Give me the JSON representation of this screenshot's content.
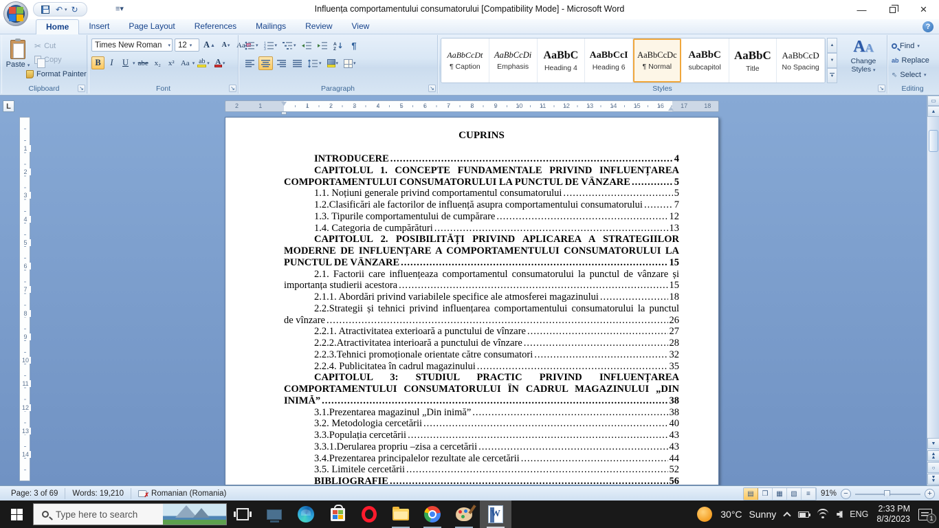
{
  "window": {
    "title": "Influența comportamentului consumatorului [Compatibility Mode]  -  Microsoft Word"
  },
  "ribbon": {
    "tabs": [
      {
        "label": "Home",
        "active": true
      },
      {
        "label": "Insert",
        "active": false
      },
      {
        "label": "Page Layout",
        "active": false
      },
      {
        "label": "References",
        "active": false
      },
      {
        "label": "Mailings",
        "active": false
      },
      {
        "label": "Review",
        "active": false
      },
      {
        "label": "View",
        "active": false
      }
    ],
    "clipboard": {
      "label": "Clipboard",
      "paste": "Paste",
      "cut": "Cut",
      "copy": "Copy",
      "format_painter": "Format Painter"
    },
    "font": {
      "label": "Font",
      "family": "Times New Roman",
      "size": "12"
    },
    "paragraph": {
      "label": "Paragraph"
    },
    "styles": {
      "label": "Styles",
      "change_styles": "Change Styles",
      "items": [
        {
          "preview": "AaBbCcDt",
          "name": "¶ Caption",
          "format": "caption",
          "selected": false
        },
        {
          "preview": "AaBbCcDi",
          "name": "Emphasis",
          "format": "emphasis",
          "selected": false
        },
        {
          "preview": "AaBbC",
          "name": "Heading 4",
          "format": "h4",
          "selected": false
        },
        {
          "preview": "AaBbCcI",
          "name": "Heading 6",
          "format": "h6",
          "selected": false
        },
        {
          "preview": "AaBbCcDc",
          "name": "¶ Normal",
          "format": "normal",
          "selected": true
        },
        {
          "preview": "AaBbC",
          "name": "subcapitol",
          "format": "subcapitol",
          "selected": false
        },
        {
          "preview": "AaBbC",
          "name": "Title",
          "format": "title",
          "selected": false
        },
        {
          "preview": "AaBbCcD",
          "name": "No Spacing",
          "format": "nospacing",
          "selected": false
        }
      ]
    },
    "editing": {
      "label": "Editing",
      "find": "Find",
      "replace": "Replace",
      "select": "Select"
    }
  },
  "ruler": {
    "left_numbers": [
      "2",
      "1"
    ],
    "center_numbers": [
      "1",
      "2",
      "3",
      "4",
      "5",
      "6",
      "7",
      "8",
      "9",
      "10",
      "11",
      "12",
      "13",
      "14",
      "15",
      "16"
    ],
    "right_numbers": [
      "17",
      "18"
    ],
    "vertical_numbers": [
      "1",
      "2",
      "3",
      "4",
      "5",
      "6",
      "7",
      "8",
      "9",
      "10",
      "11",
      "12",
      "13",
      "14"
    ]
  },
  "document": {
    "title": "CUPRINS",
    "toc": [
      {
        "lines": [
          "INTRODUCERE"
        ],
        "page": "4",
        "bold": true
      },
      {
        "lines": [
          "CAPITOLUL 1.  CONCEPTE FUNDAMENTALE  PRIVIND INFLUENȚAREA",
          "COMPORTAMENTULUI CONSUMATORULUI LA PUNCTUL DE VÂNZARE"
        ],
        "page": "5",
        "bold": true
      },
      {
        "lines": [
          "1.1. Noțiuni generale privind  comportamentul consumatorului"
        ],
        "page": "5",
        "bold": false
      },
      {
        "lines": [
          "1.2.Clasificări ale factorilor de influență asupra comportamentului consumatorului"
        ],
        "page": "7",
        "bold": false
      },
      {
        "lines": [
          "1.3. Tipurile comportamentului de cumpărare"
        ],
        "page": "12",
        "bold": false
      },
      {
        "lines": [
          "1.4. Categoria de cumpărături"
        ],
        "page": "13",
        "bold": false
      },
      {
        "lines": [
          "CAPITOLUL 2. POSIBILITĂȚI PRIVIND APLICAREA A STRATEGIILOR",
          "MODERNE DE INFLUENȚARE A COMPORTAMENTULUI CONSUMATORULUI LA",
          "PUNCTUL DE VÂNZARE"
        ],
        "page": "15",
        "bold": true
      },
      {
        "lines": [
          "2.1. Factorii care influențeaza comportamentul consumatorului la punctul de vânzare și",
          "importanța studierii acestora"
        ],
        "page": "15",
        "bold": false
      },
      {
        "lines": [
          "2.1.1. Abordări privind variabilele specifice ale atmosferei magazinului"
        ],
        "page": "18",
        "bold": false
      },
      {
        "lines": [
          "2.2.Strategii și tehnici privind influențarea comportamentului consumatorului la punctul",
          "de vînzare"
        ],
        "page": "26",
        "bold": false
      },
      {
        "lines": [
          "2.2.1. Atractivitatea exterioară a punctului de vînzare"
        ],
        "page": "27",
        "bold": false
      },
      {
        "lines": [
          "2.2.2.Atractivitatea interioară  a punctului de vînzare"
        ],
        "page": "28",
        "bold": false
      },
      {
        "lines": [
          "2.2.3.Tehnici promoționale orientate către consumatori"
        ],
        "page": "32",
        "bold": false
      },
      {
        "lines": [
          "2.2.4.  Publicitatea în cadrul magazinului"
        ],
        "page": "35",
        "bold": false
      },
      {
        "lines": [
          "CAPITOLUL   3:   STUDIUL   PRACTIC   PRIVIND   INFLUENȚAREA",
          "COMPORTAMENTULUI CONSUMATORULUI ÎN CADRUL MAGAZINULUI „DIN",
          "INIMĂ”"
        ],
        "page": "38",
        "bold": true
      },
      {
        "lines": [
          "3.1.Prezentarea magazinul  „Din inimă”"
        ],
        "page": "38",
        "bold": false
      },
      {
        "lines": [
          "3.2. Metodologia cercetării"
        ],
        "page": "40",
        "bold": false
      },
      {
        "lines": [
          "3.3.Populația cercetării"
        ],
        "page": "43",
        "bold": false
      },
      {
        "lines": [
          "3.3.1.Derularea propriu –zisa a cercetării"
        ],
        "page": "43",
        "bold": false
      },
      {
        "lines": [
          "3.4.Prezentarea principalelor rezultate ale cercetării"
        ],
        "page": "44",
        "bold": false
      },
      {
        "lines": [
          "3.5. Limitele cercetării"
        ],
        "page": "52",
        "bold": false
      },
      {
        "lines": [
          "BIBLIOGRAFIE"
        ],
        "page": "56",
        "bold": true
      }
    ]
  },
  "status_bar": {
    "page": "Page: 3 of 69",
    "words": "Words: 19,210",
    "language": "Romanian (Romania)",
    "zoom": "91%"
  },
  "taskbar": {
    "search_placeholder": "Type here to search",
    "weather": {
      "temp": "30°C",
      "condition": "Sunny"
    },
    "tray": {
      "lang": "ENG",
      "time": "2:33 PM",
      "date": "8/3/2023",
      "notification_count": "1"
    }
  }
}
